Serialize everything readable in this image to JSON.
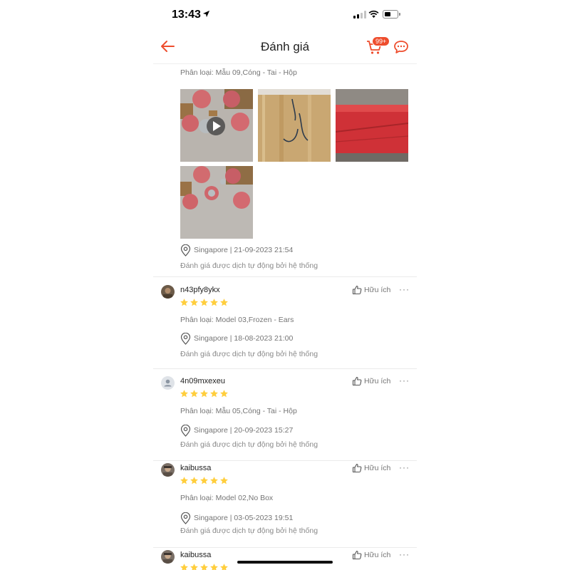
{
  "status_bar": {
    "time": "13:43"
  },
  "nav": {
    "title": "Đánh giá",
    "cart_badge": "99+"
  },
  "first_review": {
    "variant": "Phân loại: Mẫu 09,Cóng - Tai - Hộp",
    "location": "Singapore | 21-09-2023 21:54",
    "translated_note": "Đánh giá được dịch tự động bởi hệ thống"
  },
  "reviews": [
    {
      "username": "n43pfy8ykx",
      "rating": 5,
      "helpful_label": "Hữu ích",
      "variant": "Phân loại: Model 03,Frozen - Ears",
      "location": "Singapore | 18-08-2023 21:00",
      "translated_note": "Đánh giá được dịch tự động bởi hệ thống"
    },
    {
      "username": "4n09mxexeu",
      "rating": 5,
      "helpful_label": "Hữu ích",
      "variant": "Phân loại: Mẫu 05,Cóng - Tai - Hộp",
      "location": "Singapore | 20-09-2023 15:27",
      "translated_note": "Đánh giá được dịch tự động bởi hệ thống"
    },
    {
      "username": "kaibussa",
      "rating": 5,
      "helpful_label": "Hữu ích",
      "variant": "Phân loại: Model 02,No Box",
      "location": "Singapore | 03-05-2023 19:51",
      "translated_note": "Đánh giá được dịch tự động bởi hệ thống"
    },
    {
      "username": "kaibussa",
      "rating": 5,
      "helpful_label": "Hữu ích"
    }
  ],
  "colors": {
    "accent": "#ee4d2d",
    "star": "#ffce3d",
    "muted_text": "#757575"
  },
  "icons": [
    "back-arrow-icon",
    "cart-icon",
    "chat-icon",
    "play-icon",
    "location-pin-icon",
    "thumbs-up-icon",
    "more-icon",
    "star-icon"
  ]
}
